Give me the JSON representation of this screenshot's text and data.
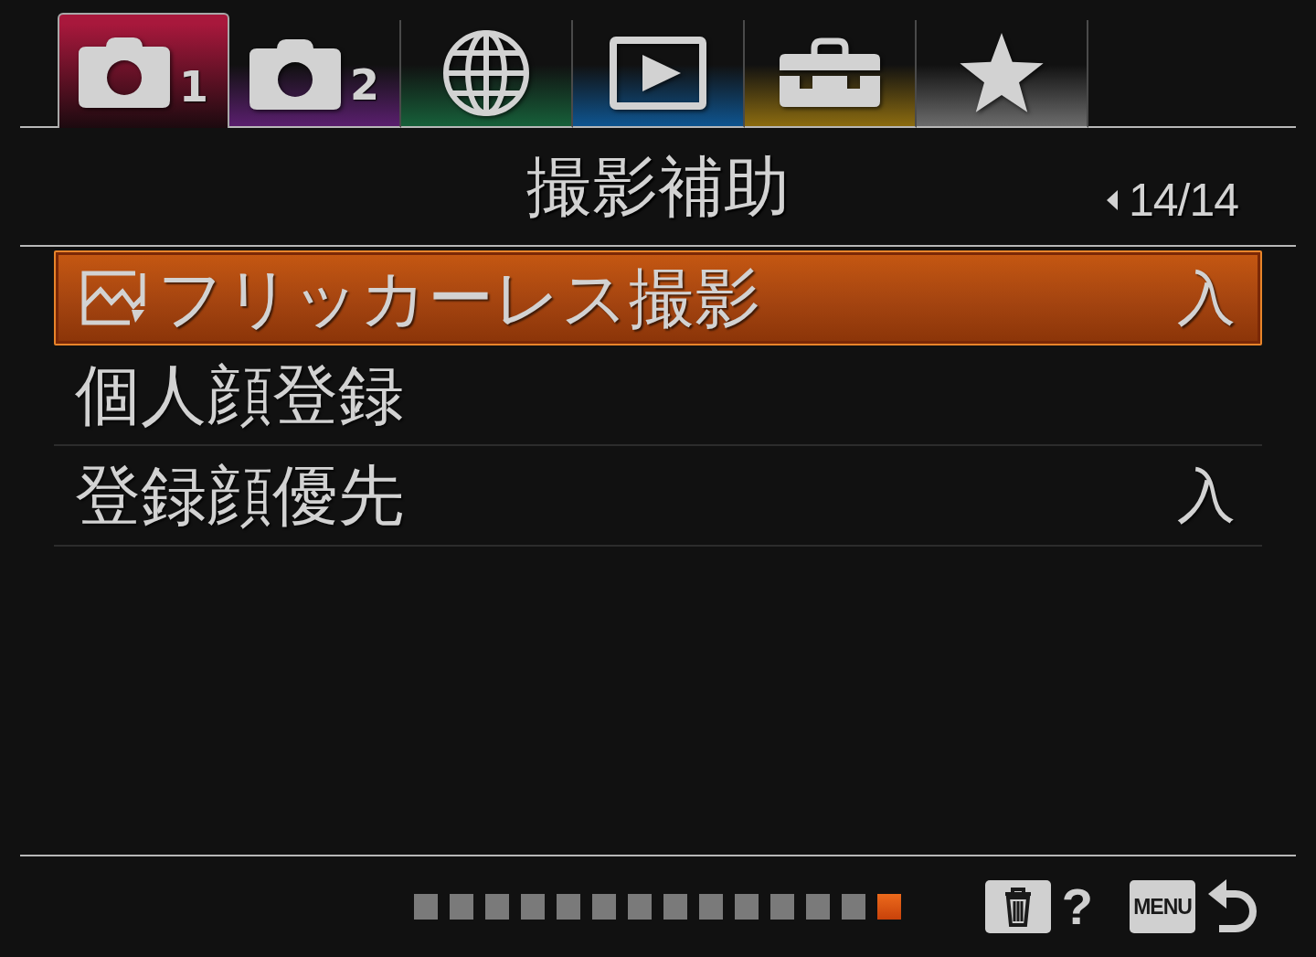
{
  "tabs": [
    {
      "kind": "camera",
      "number": "1",
      "color": "#a8183c",
      "selected": true
    },
    {
      "kind": "camera",
      "number": "2",
      "color": "#5a1f6e",
      "selected": false
    },
    {
      "kind": "globe",
      "color": "#17603a",
      "selected": false
    },
    {
      "kind": "playback",
      "color": "#0f5590",
      "selected": false
    },
    {
      "kind": "toolbox",
      "color": "#8c6c10",
      "selected": false
    },
    {
      "kind": "star",
      "color": "#6c6c6c",
      "selected": false
    }
  ],
  "header": {
    "title": "撮影補助",
    "page": "14/14"
  },
  "items": [
    {
      "label": "フリッカーレス撮影",
      "icon": true,
      "value": "入",
      "selected": true
    },
    {
      "label": "個人顔登録",
      "icon": false,
      "selected": false
    },
    {
      "label": "登録顔優先",
      "icon": false,
      "value": "入",
      "selected": false
    }
  ],
  "footer": {
    "page_dots": [
      {
        "selected": false
      },
      {
        "selected": false
      },
      {
        "selected": false
      },
      {
        "selected": false
      },
      {
        "selected": false
      },
      {
        "selected": false
      },
      {
        "selected": false
      },
      {
        "selected": false
      },
      {
        "selected": false
      },
      {
        "selected": false
      },
      {
        "selected": false
      },
      {
        "selected": false
      },
      {
        "selected": false
      },
      {
        "selected": true
      }
    ],
    "help_label": "?",
    "menu_key": "MENU"
  }
}
